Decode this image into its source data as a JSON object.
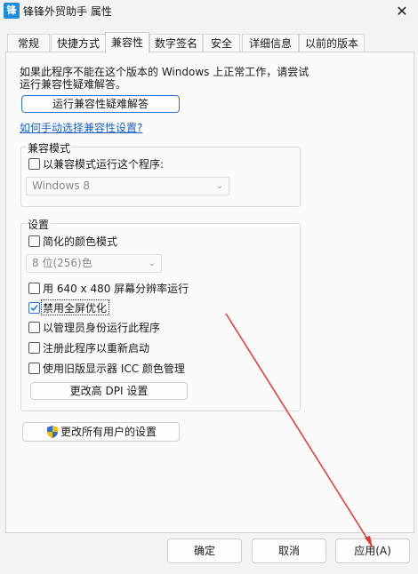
{
  "window": {
    "app_icon_char": "锋",
    "title": "锋锋外贸助手 属性",
    "close": "✕"
  },
  "tabs": [
    {
      "label": "常规"
    },
    {
      "label": "快捷方式"
    },
    {
      "label": "兼容性"
    },
    {
      "label": "数字签名"
    },
    {
      "label": "安全"
    },
    {
      "label": "详细信息"
    },
    {
      "label": "以前的版本"
    }
  ],
  "intro": {
    "line1": "如果此程序不能在这个版本的 Windows 上正常工作，请尝试",
    "line2": "运行兼容性疑难解答。"
  },
  "troubleshoot_button": "运行兼容性疑难解答",
  "manual_link": "如何手动选择兼容性设置?",
  "compat_mode": {
    "label": "兼容模式",
    "checkbox": "以兼容模式运行这个程序:",
    "select_value": "Windows 8"
  },
  "settings": {
    "label": "设置",
    "reduced_color": "简化的颜色模式",
    "color_select": "8 位(256)色",
    "res_640": "用 640 x 480 屏幕分辨率运行",
    "disable_fullscreen": "禁用全屏优化",
    "run_admin": "以管理员身份运行此程序",
    "register_restart": "注册此程序以重新启动",
    "legacy_icc": "使用旧版显示器 ICC 颜色管理",
    "dpi_button": "更改高 DPI 设置"
  },
  "all_users_button": "更改所有用户的设置",
  "footer": {
    "ok": "确定",
    "cancel": "取消",
    "apply": "应用(A)"
  },
  "colors": {
    "accent": "#2d74d6",
    "link": "#1f62c1",
    "annotation_arrow": "#e8352a"
  },
  "icons": {
    "shield": "uac-shield-icon",
    "check": "checkmark-icon",
    "chevron": "chevron-down-icon"
  }
}
